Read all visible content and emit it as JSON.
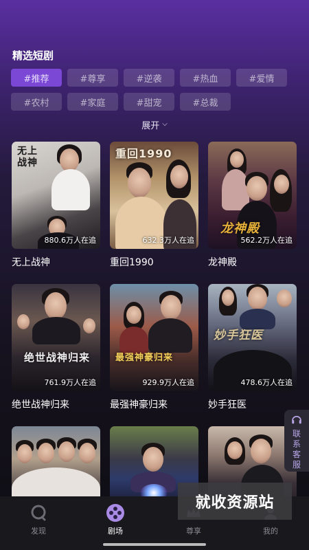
{
  "section_title": "精选短剧",
  "tags": [
    "#推荐",
    "#尊享",
    "#逆袭",
    "#热血",
    "#爱情",
    "#农村",
    "#家庭",
    "#甜宠",
    "#总裁"
  ],
  "expand_label": "展开",
  "dramas": [
    {
      "title": "无上战神",
      "views": "880.6万人在追",
      "overlay": "无上战神"
    },
    {
      "title": "重回1990",
      "views": "632.3万人在追",
      "overlay": "重回1990"
    },
    {
      "title": "龙神殿",
      "views": "562.2万人在追",
      "overlay": "龙神殿"
    },
    {
      "title": "绝世战神归来",
      "views": "761.9万人在追",
      "overlay": "绝世战神归来"
    },
    {
      "title": "最强神豪归来",
      "views": "929.9万人在追",
      "overlay": "最强神豪归来"
    },
    {
      "title": "妙手狂医",
      "views": "478.6万人在追",
      "overlay": "妙手狂医"
    },
    {
      "title": "",
      "views": "",
      "overlay": ""
    },
    {
      "title": "",
      "views": "",
      "overlay": ""
    },
    {
      "title": "",
      "views": "",
      "overlay": ""
    }
  ],
  "contact_label": "联系客服",
  "tabs": [
    {
      "label": "发现",
      "icon": "discover-icon"
    },
    {
      "label": "剧场",
      "icon": "theater-icon"
    },
    {
      "label": "尊享",
      "icon": "vip-icon"
    },
    {
      "label": "我的",
      "icon": "profile-icon"
    }
  ],
  "watermark": "就收资源站",
  "colors": {
    "accent": "#7b48d6",
    "tab_active": "#ffffff",
    "tab_inactive": "#8c8a93"
  }
}
